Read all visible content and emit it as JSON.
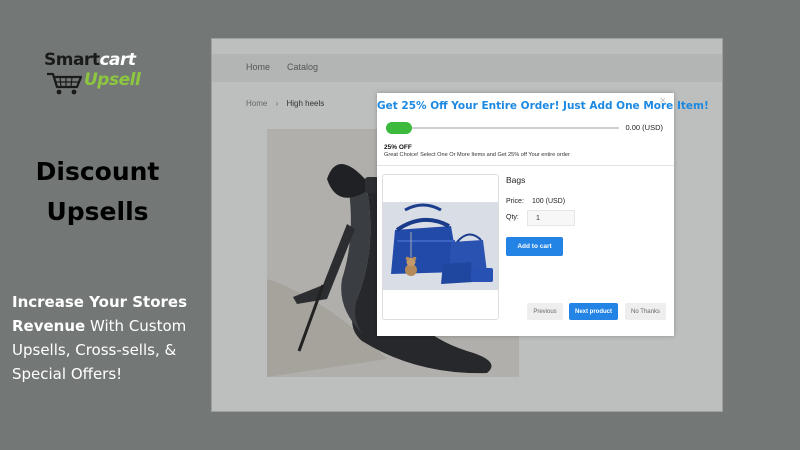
{
  "brand": {
    "word_smart": "Smart",
    "word_cart": "cart",
    "word_upsell": "Upsell",
    "accent_color": "#8dc63f"
  },
  "headline": {
    "line1": "Discount",
    "line2": "Upsells"
  },
  "tagline": {
    "bold1": "Increase Your Stores",
    "bold2": "Revenue",
    "rest": " With Custom Upsells, Cross-sells, & Special Offers!"
  },
  "store": {
    "nav": [
      "Home",
      "Catalog"
    ],
    "breadcrumb": [
      "Home",
      "›",
      "High heels"
    ],
    "product_image_icon": "high-heel-shoe-image"
  },
  "modal": {
    "title": "Get 25% Off Your Entire Order! Just Add One More Item!",
    "close": "×",
    "progress": {
      "fraction": 0.11,
      "amount": "0.00 (USD)",
      "color": "#3cba3c"
    },
    "offer_pct": "25% OFF",
    "offer_desc": "Great Choice! Select One Or More Items and Get 25% off Your entire order",
    "item": {
      "name": "Bags",
      "price_label": "Price:",
      "price": "100 (USD)",
      "qty_label": "Qty:",
      "qty_value": "1",
      "image_icon": "handbag-set-image"
    },
    "buttons": {
      "add_to_cart": "Add to cart",
      "previous": "Previous",
      "next": "Next product",
      "no_thanks": "No Thanks"
    },
    "primary_color": "#2384e6",
    "title_color": "#1b88e2"
  }
}
